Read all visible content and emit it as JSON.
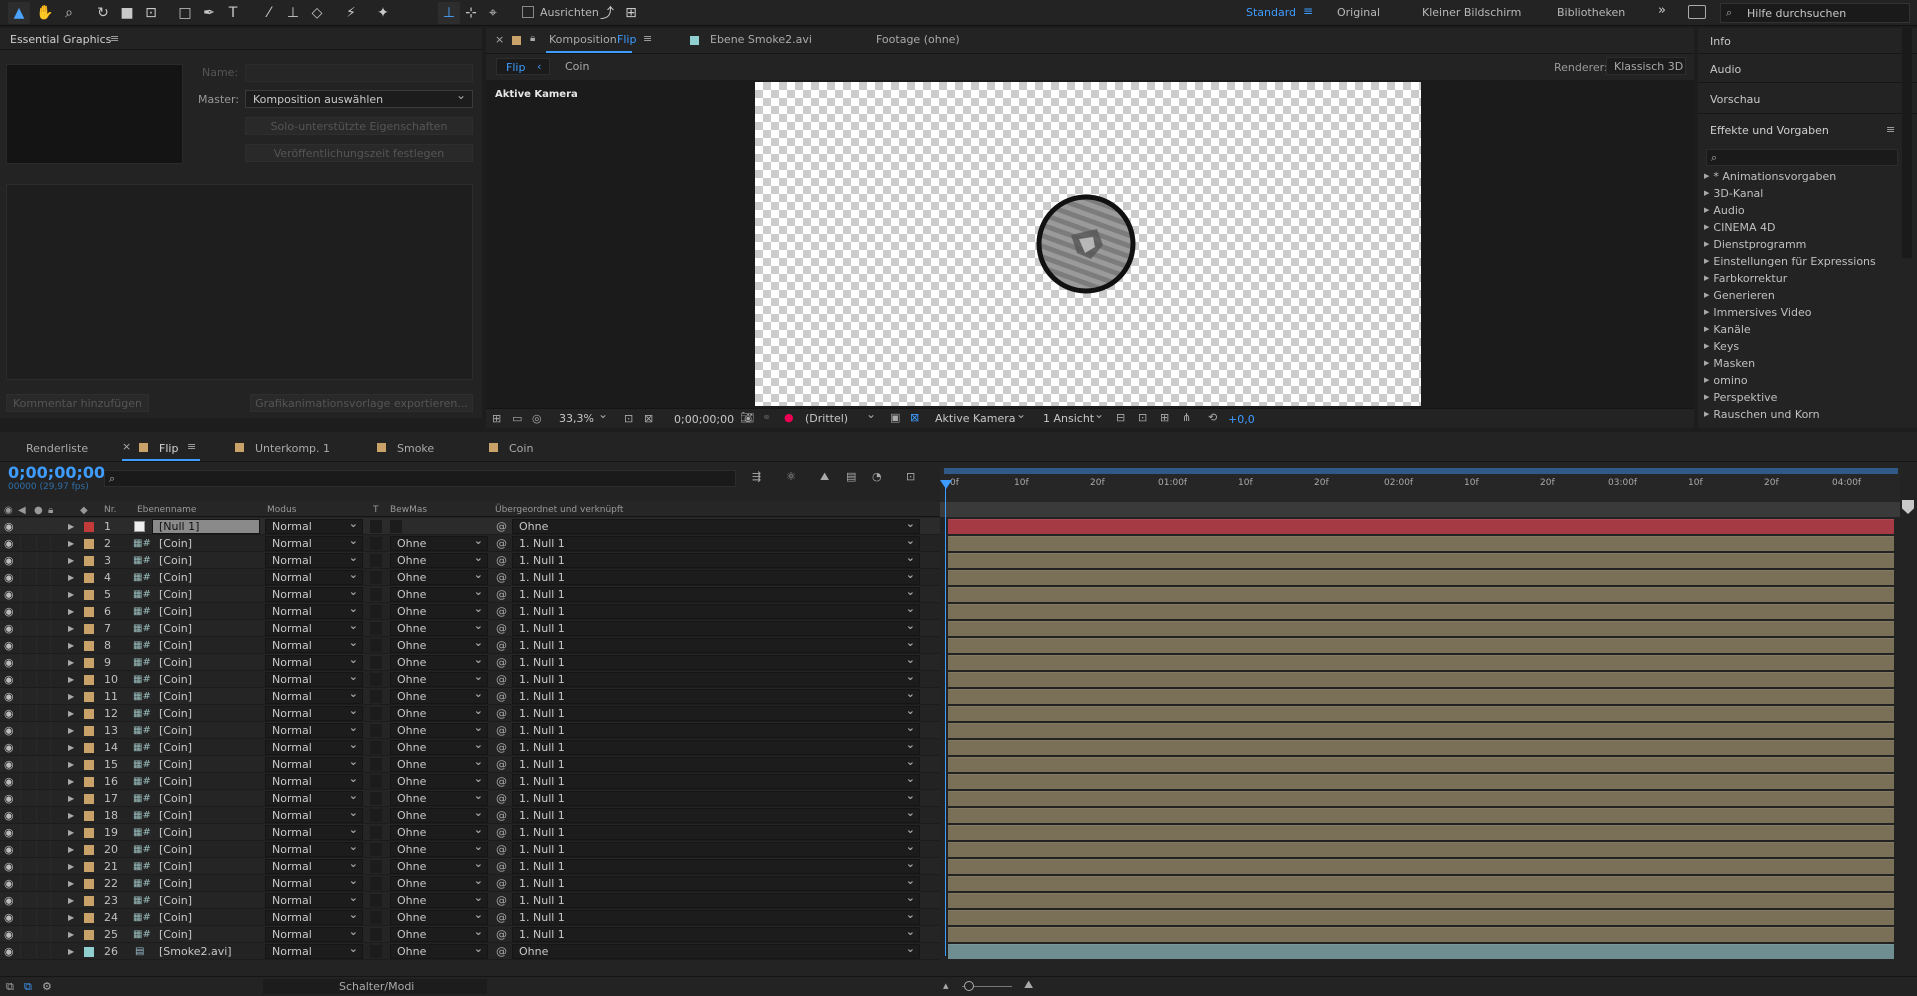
{
  "toolbar": {
    "ausrichten": "Ausrichten",
    "workspaces": [
      "Standard",
      "Original",
      "Kleiner Bildschirm",
      "Bibliotheken"
    ],
    "active_workspace": "Standard",
    "help_placeholder": "Hilfe durchsuchen"
  },
  "essential_graphics": {
    "title": "Essential Graphics",
    "name_label": "Name:",
    "master_label": "Master:",
    "master_value": "Komposition auswählen",
    "btn_solo": "Solo-unterstützte Eigenschaften",
    "btn_release": "Veröffentlichungszeit festlegen",
    "btn_comment": "Kommentar hinzufügen",
    "btn_export": "Grafikanimationsvorlage exportieren..."
  },
  "viewer": {
    "tab_comp_prefix": "Komposition",
    "tab_comp_name": "Flip",
    "tab_layer": "Ebene  Smoke2.avi",
    "tab_footage": "Footage (ohne)",
    "crumb_active": "Flip",
    "crumb_next": "Coin",
    "renderer_label": "Renderer:",
    "renderer_value": "Klassisch 3D",
    "camera_label": "Aktive Kamera",
    "zoom": "33,3%",
    "timecode": "0;00;00;00",
    "resolution": "(Drittel)",
    "camera_select": "Aktive Kamera",
    "views": "1 Ansicht",
    "exposure": "+0,0"
  },
  "right_panel": {
    "info": "Info",
    "audio": "Audio",
    "preview": "Vorschau",
    "effects_title": "Effekte und Vorgaben",
    "effects": [
      "* Animationsvorgaben",
      "3D-Kanal",
      "Audio",
      "CINEMA 4D",
      "Dienstprogramm",
      "Einstellungen für Expressions",
      "Farbkorrektur",
      "Generieren",
      "Immersives Video",
      "Kanäle",
      "Keys",
      "Masken",
      "omino",
      "Perspektive",
      "Rauschen und Korn"
    ]
  },
  "timeline": {
    "tabs": [
      "Renderliste",
      "Flip",
      "Unterkomp. 1",
      "Smoke",
      "Coin"
    ],
    "active_tab": "Flip",
    "timecode": "0;00;00;00",
    "fps": "00000 (29,97 fps)",
    "headers": {
      "nr": "Nr.",
      "name": "Ebenenname",
      "mode": "Modus",
      "t": "T",
      "trkmat": "BewMas",
      "parent": "Übergeordnet und verknüpft"
    },
    "ruler": [
      "0f",
      "10f",
      "20f",
      "01:00f",
      "10f",
      "20f",
      "02:00f",
      "10f",
      "20f",
      "03:00f",
      "10f",
      "20f",
      "04:00f"
    ],
    "footer_label": "Schalter/Modi",
    "layers": [
      {
        "nr": "1",
        "name": "[Null 1]",
        "mode": "Normal",
        "trkmat": "",
        "parent": "Ohne",
        "type": "null"
      },
      {
        "nr": "2",
        "name": "[Coin]",
        "mode": "Normal",
        "trkmat": "Ohne",
        "parent": "1. Null 1",
        "type": "comp"
      },
      {
        "nr": "3",
        "name": "[Coin]",
        "mode": "Normal",
        "trkmat": "Ohne",
        "parent": "1. Null 1",
        "type": "comp"
      },
      {
        "nr": "4",
        "name": "[Coin]",
        "mode": "Normal",
        "trkmat": "Ohne",
        "parent": "1. Null 1",
        "type": "comp"
      },
      {
        "nr": "5",
        "name": "[Coin]",
        "mode": "Normal",
        "trkmat": "Ohne",
        "parent": "1. Null 1",
        "type": "comp"
      },
      {
        "nr": "6",
        "name": "[Coin]",
        "mode": "Normal",
        "trkmat": "Ohne",
        "parent": "1. Null 1",
        "type": "comp"
      },
      {
        "nr": "7",
        "name": "[Coin]",
        "mode": "Normal",
        "trkmat": "Ohne",
        "parent": "1. Null 1",
        "type": "comp"
      },
      {
        "nr": "8",
        "name": "[Coin]",
        "mode": "Normal",
        "trkmat": "Ohne",
        "parent": "1. Null 1",
        "type": "comp"
      },
      {
        "nr": "9",
        "name": "[Coin]",
        "mode": "Normal",
        "trkmat": "Ohne",
        "parent": "1. Null 1",
        "type": "comp"
      },
      {
        "nr": "10",
        "name": "[Coin]",
        "mode": "Normal",
        "trkmat": "Ohne",
        "parent": "1. Null 1",
        "type": "comp"
      },
      {
        "nr": "11",
        "name": "[Coin]",
        "mode": "Normal",
        "trkmat": "Ohne",
        "parent": "1. Null 1",
        "type": "comp"
      },
      {
        "nr": "12",
        "name": "[Coin]",
        "mode": "Normal",
        "trkmat": "Ohne",
        "parent": "1. Null 1",
        "type": "comp"
      },
      {
        "nr": "13",
        "name": "[Coin]",
        "mode": "Normal",
        "trkmat": "Ohne",
        "parent": "1. Null 1",
        "type": "comp"
      },
      {
        "nr": "14",
        "name": "[Coin]",
        "mode": "Normal",
        "trkmat": "Ohne",
        "parent": "1. Null 1",
        "type": "comp"
      },
      {
        "nr": "15",
        "name": "[Coin]",
        "mode": "Normal",
        "trkmat": "Ohne",
        "parent": "1. Null 1",
        "type": "comp"
      },
      {
        "nr": "16",
        "name": "[Coin]",
        "mode": "Normal",
        "trkmat": "Ohne",
        "parent": "1. Null 1",
        "type": "comp"
      },
      {
        "nr": "17",
        "name": "[Coin]",
        "mode": "Normal",
        "trkmat": "Ohne",
        "parent": "1. Null 1",
        "type": "comp"
      },
      {
        "nr": "18",
        "name": "[Coin]",
        "mode": "Normal",
        "trkmat": "Ohne",
        "parent": "1. Null 1",
        "type": "comp"
      },
      {
        "nr": "19",
        "name": "[Coin]",
        "mode": "Normal",
        "trkmat": "Ohne",
        "parent": "1. Null 1",
        "type": "comp"
      },
      {
        "nr": "20",
        "name": "[Coin]",
        "mode": "Normal",
        "trkmat": "Ohne",
        "parent": "1. Null 1",
        "type": "comp"
      },
      {
        "nr": "21",
        "name": "[Coin]",
        "mode": "Normal",
        "trkmat": "Ohne",
        "parent": "1. Null 1",
        "type": "comp"
      },
      {
        "nr": "22",
        "name": "[Coin]",
        "mode": "Normal",
        "trkmat": "Ohne",
        "parent": "1. Null 1",
        "type": "comp"
      },
      {
        "nr": "23",
        "name": "[Coin]",
        "mode": "Normal",
        "trkmat": "Ohne",
        "parent": "1. Null 1",
        "type": "comp"
      },
      {
        "nr": "24",
        "name": "[Coin]",
        "mode": "Normal",
        "trkmat": "Ohne",
        "parent": "1. Null 1",
        "type": "comp"
      },
      {
        "nr": "25",
        "name": "[Coin]",
        "mode": "Normal",
        "trkmat": "Ohne",
        "parent": "1. Null 1",
        "type": "comp"
      },
      {
        "nr": "26",
        "name": "[Smoke2.avi]",
        "mode": "Normal",
        "trkmat": "Ohne",
        "parent": "Ohne",
        "type": "footage"
      }
    ]
  },
  "colors": {
    "accent": "#3e9cff",
    "null_label": "#c33a3a",
    "comp_label": "#c9a26a",
    "footage_label": "#8fcfcf",
    "null_bar": "#a53a44",
    "comp_bar": "#7a7057",
    "footage_bar": "#6e8e92"
  }
}
